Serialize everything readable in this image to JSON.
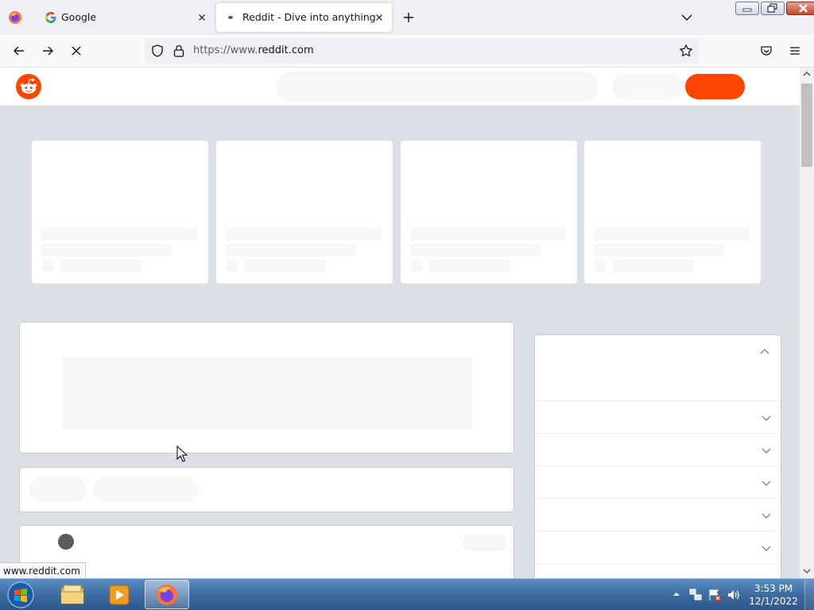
{
  "browser": {
    "tabs": [
      {
        "title": "Google",
        "favicon": "google-g-icon",
        "active": false
      },
      {
        "title": "Reddit - Dive into anything",
        "favicon": "loading-dot-icon",
        "active": true
      }
    ],
    "url_prefix": "https://www.",
    "url_host": "reddit.com",
    "status_link": "www.reddit.com"
  },
  "page": {
    "brand_color": "#ff4500",
    "skeleton_color": "#f6f7f8",
    "background_color": "#dae0e6",
    "trending_cards": 4,
    "sidebar_sections": 7,
    "state": "loading"
  },
  "taskbar": {
    "time": "3:53 PM",
    "date": "12/1/2022",
    "pinned": [
      "windows-explorer-icon",
      "media-player-icon",
      "firefox-icon"
    ]
  }
}
